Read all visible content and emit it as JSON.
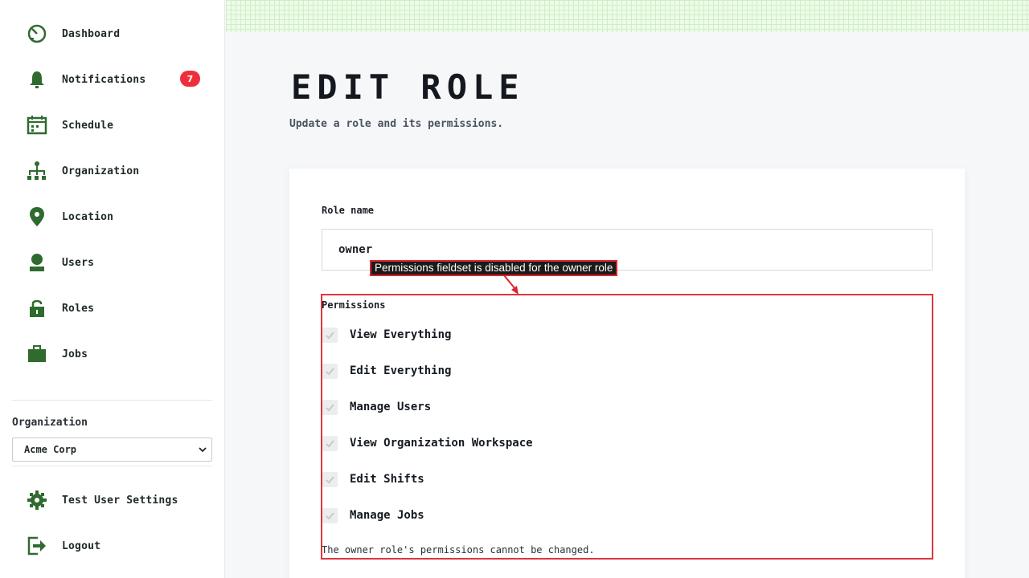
{
  "sidebar": {
    "items": [
      {
        "label": "Dashboard",
        "icon": "dashboard-icon"
      },
      {
        "label": "Notifications",
        "icon": "bell-icon",
        "badge": "7"
      },
      {
        "label": "Schedule",
        "icon": "calendar-icon"
      },
      {
        "label": "Organization",
        "icon": "org-chart-icon"
      },
      {
        "label": "Location",
        "icon": "map-pin-icon"
      },
      {
        "label": "Users",
        "icon": "user-icon"
      },
      {
        "label": "Roles",
        "icon": "lock-icon"
      },
      {
        "label": "Jobs",
        "icon": "briefcase-icon"
      }
    ],
    "organization_label": "Organization",
    "organization_selected": "Acme Corp",
    "settings_label": "Test User Settings",
    "logout_label": "Logout"
  },
  "main": {
    "title": "EDIT ROLE",
    "subtitle": "Update a role and its permissions.",
    "role_name_label": "Role name",
    "role_name_value": "owner",
    "annotation": "Permissions fieldset is disabled for the owner role",
    "permissions_label": "Permissions",
    "permissions": [
      {
        "label": "View Everything",
        "checked": true
      },
      {
        "label": "Edit Everything",
        "checked": true
      },
      {
        "label": "Manage Users",
        "checked": true
      },
      {
        "label": "View Organization Workspace",
        "checked": true
      },
      {
        "label": "Edit Shifts",
        "checked": true
      },
      {
        "label": "Manage Jobs",
        "checked": true
      }
    ],
    "permissions_note": "The owner role's permissions cannot be changed."
  },
  "colors": {
    "icon_green": "#2f6b2f",
    "badge_red": "#ee2f3b",
    "annotation_red": "#e0353c"
  }
}
